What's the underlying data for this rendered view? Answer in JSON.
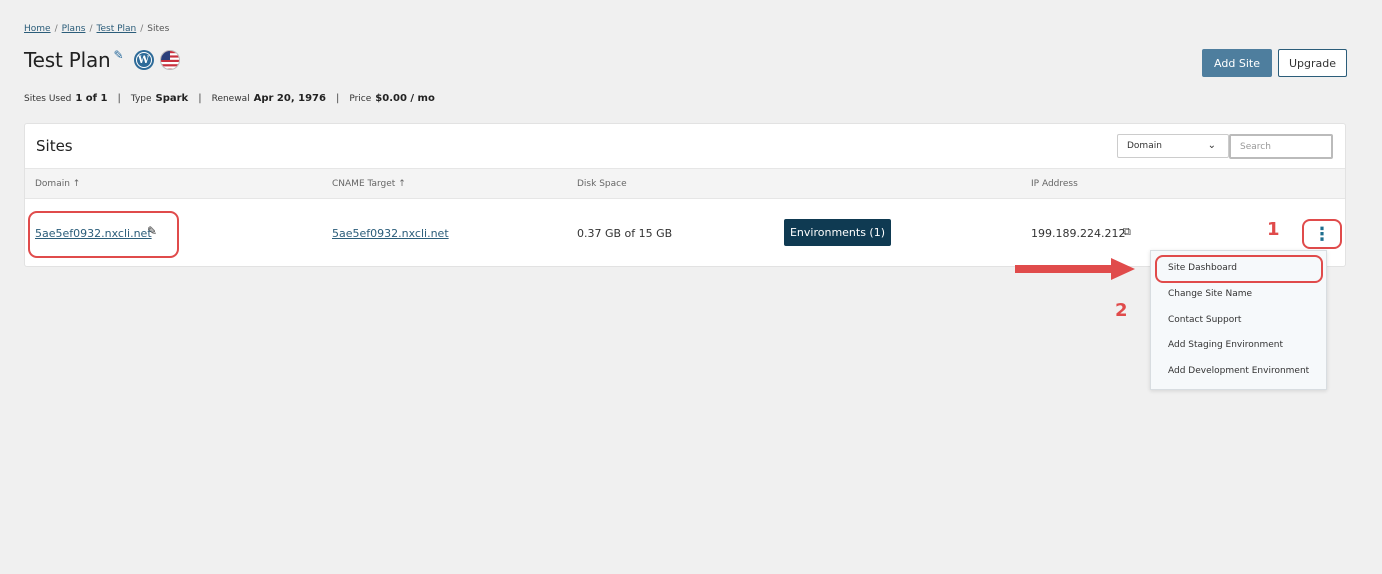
{
  "breadcrumb": {
    "home": "Home",
    "plans": "Plans",
    "test_plan": "Test Plan",
    "current": "Sites",
    "separator": "/"
  },
  "header": {
    "title": "Test Plan",
    "add_site": "Add Site",
    "upgrade": "Upgrade"
  },
  "stats": {
    "sites_used_label": "Sites Used",
    "sites_used_value": "1 of 1",
    "type_label": "Type",
    "type_value": "Spark",
    "renewal_label": "Renewal",
    "renewal_value": "Apr 20, 1976",
    "price_label": "Price",
    "price_value": "$0.00 / mo",
    "separator": "|"
  },
  "sites": {
    "title": "Sites",
    "filter_value": "Domain",
    "search_placeholder": "Search",
    "columns": {
      "domain": "Domain ↑",
      "cname": "CNAME Target ↑",
      "disk": "Disk Space",
      "ip": "IP Address"
    },
    "row": {
      "domain": "5ae5ef0932.nxcli.net",
      "cname": "5ae5ef0932.nxcli.net",
      "disk": "0.37 GB of 15 GB",
      "environments": "Environments (1)",
      "ip": "199.189.224.212"
    }
  },
  "menu": {
    "items": [
      "Site Dashboard",
      "Change Site Name",
      "Contact Support",
      "Add Staging Environment",
      "Add Development Environment"
    ]
  },
  "annotations": {
    "step1": "1",
    "step2": "2",
    "color": "#e04b4b"
  },
  "colors": {
    "primary": "#0f3a52",
    "link": "#2b5d7a",
    "add_site_bg": "#4e7e9e"
  }
}
